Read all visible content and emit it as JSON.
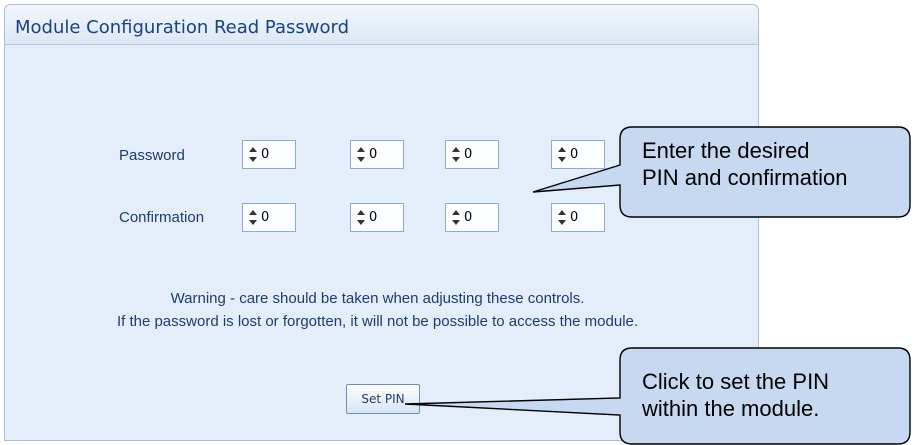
{
  "window": {
    "title": "Module Configuration Read Password"
  },
  "password": {
    "label": "Password",
    "digits": [
      "0",
      "0",
      "0",
      "0"
    ]
  },
  "confirmation": {
    "label": "Confirmation",
    "digits": [
      "0",
      "0",
      "0",
      "0"
    ]
  },
  "warning": {
    "line1": "Warning - care should be taken when adjusting these controls.",
    "line2": "If the password is lost or forgotten, it will not be possible to access the module."
  },
  "actions": {
    "set_pin_label": "Set PIN"
  },
  "callouts": {
    "pin_line1": "Enter the desired",
    "pin_line2": "PIN and confirmation",
    "set_line1": "Click to set the PIN",
    "set_line2": "within the module."
  },
  "colors": {
    "panel_bg": "#e4eefa",
    "title_text": "#15428b",
    "callout_fill": "#c6d9f1",
    "label_text": "#1f3c6e"
  }
}
